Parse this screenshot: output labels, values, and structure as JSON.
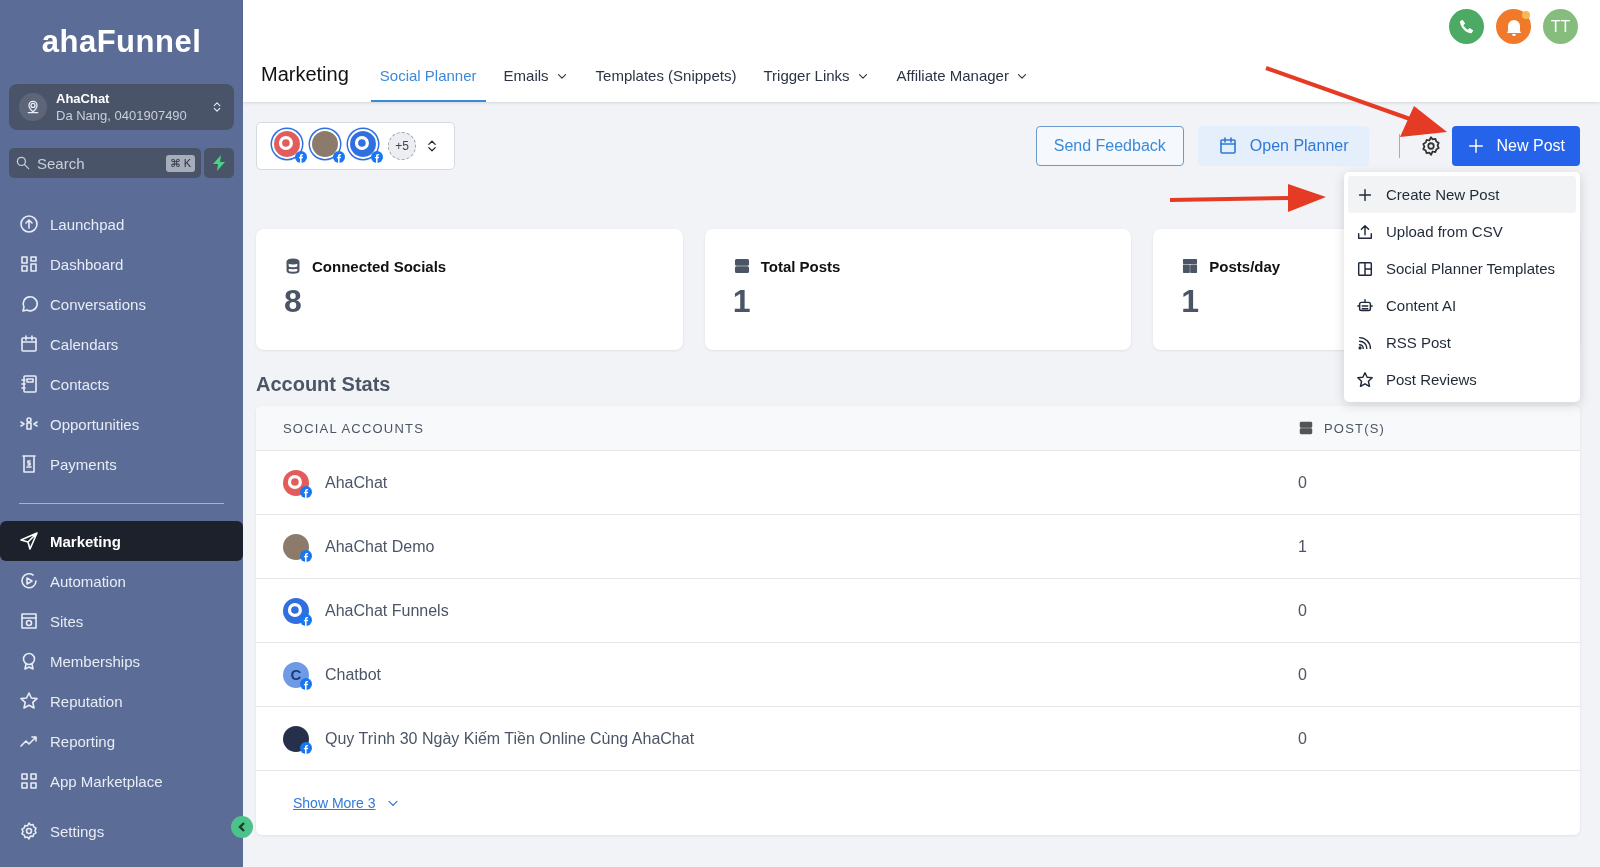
{
  "sidebar": {
    "logo": "ahaFunnel",
    "account": {
      "name": "AhaChat",
      "detail": "Da Nang, 0401907490"
    },
    "search": {
      "placeholder": "Search",
      "shortcut": "⌘ K"
    },
    "nav_groups": [
      [
        {
          "label": "Launchpad",
          "selected": false
        },
        {
          "label": "Dashboard",
          "selected": false
        },
        {
          "label": "Conversations",
          "selected": false
        },
        {
          "label": "Calendars",
          "selected": false
        },
        {
          "label": "Contacts",
          "selected": false
        },
        {
          "label": "Opportunities",
          "selected": false
        },
        {
          "label": "Payments",
          "selected": false
        }
      ],
      [
        {
          "label": "Marketing",
          "selected": true
        },
        {
          "label": "Automation",
          "selected": false
        },
        {
          "label": "Sites",
          "selected": false
        },
        {
          "label": "Memberships",
          "selected": false
        },
        {
          "label": "Reputation",
          "selected": false
        },
        {
          "label": "Reporting",
          "selected": false
        },
        {
          "label": "App Marketplace",
          "selected": false
        }
      ],
      [
        {
          "label": "Settings",
          "selected": false
        }
      ]
    ]
  },
  "header": {
    "title": "Marketing",
    "tabs": [
      {
        "label": "Social Planner",
        "selected": true,
        "dropdown": false
      },
      {
        "label": "Emails",
        "selected": false,
        "dropdown": true
      },
      {
        "label": "Templates (Snippets)",
        "selected": false,
        "dropdown": false
      },
      {
        "label": "Trigger Links",
        "selected": false,
        "dropdown": true
      },
      {
        "label": "Affiliate Manager",
        "selected": false,
        "dropdown": true
      }
    ],
    "user_initials": "TT",
    "notification_dot": true
  },
  "toolbar": {
    "accounts": [
      {
        "kind": "logo",
        "color": "#e35b5b"
      },
      {
        "kind": "photo",
        "color": "#8c7b6b"
      },
      {
        "kind": "logo",
        "color": "#2f6fe0"
      }
    ],
    "more": "+5",
    "send_feedback": "Send Feedback",
    "open_planner": "Open Planner",
    "new_post": "New Post"
  },
  "new_post_menu": [
    {
      "label": "Create New Post",
      "selected": true
    },
    {
      "label": "Upload from CSV",
      "selected": false
    },
    {
      "label": "Social Planner Templates",
      "selected": false
    },
    {
      "label": "Content AI",
      "selected": false
    },
    {
      "label": "RSS Post",
      "selected": false
    },
    {
      "label": "Post Reviews",
      "selected": false
    }
  ],
  "stats": [
    {
      "label": "Connected Socials",
      "value": "8"
    },
    {
      "label": "Total Posts",
      "value": "1"
    },
    {
      "label": "Posts/day",
      "value": "1"
    }
  ],
  "account_stats": {
    "title": "Account Stats",
    "columns": [
      "SOCIAL ACCOUNTS",
      "POST(S)"
    ],
    "rows": [
      {
        "name": "AhaChat",
        "posts": "0",
        "avatar": {
          "kind": "logo",
          "color": "#e35b5b"
        }
      },
      {
        "name": "AhaChat Demo",
        "posts": "1",
        "avatar": {
          "kind": "photo",
          "color": "#8c7b6b"
        }
      },
      {
        "name": "AhaChat Funnels",
        "posts": "0",
        "avatar": {
          "kind": "logo",
          "color": "#2f6fe0"
        }
      },
      {
        "name": "Chatbot",
        "posts": "0",
        "avatar": {
          "kind": "letter",
          "letter": "C",
          "color": "#6f9be6"
        }
      },
      {
        "name": "Quy Trình 30 Ngày Kiếm Tiền Online Cùng AhaChat",
        "posts": "0",
        "avatar": {
          "kind": "photo",
          "color": "#26304a"
        }
      }
    ],
    "show_more": "Show More 3"
  }
}
